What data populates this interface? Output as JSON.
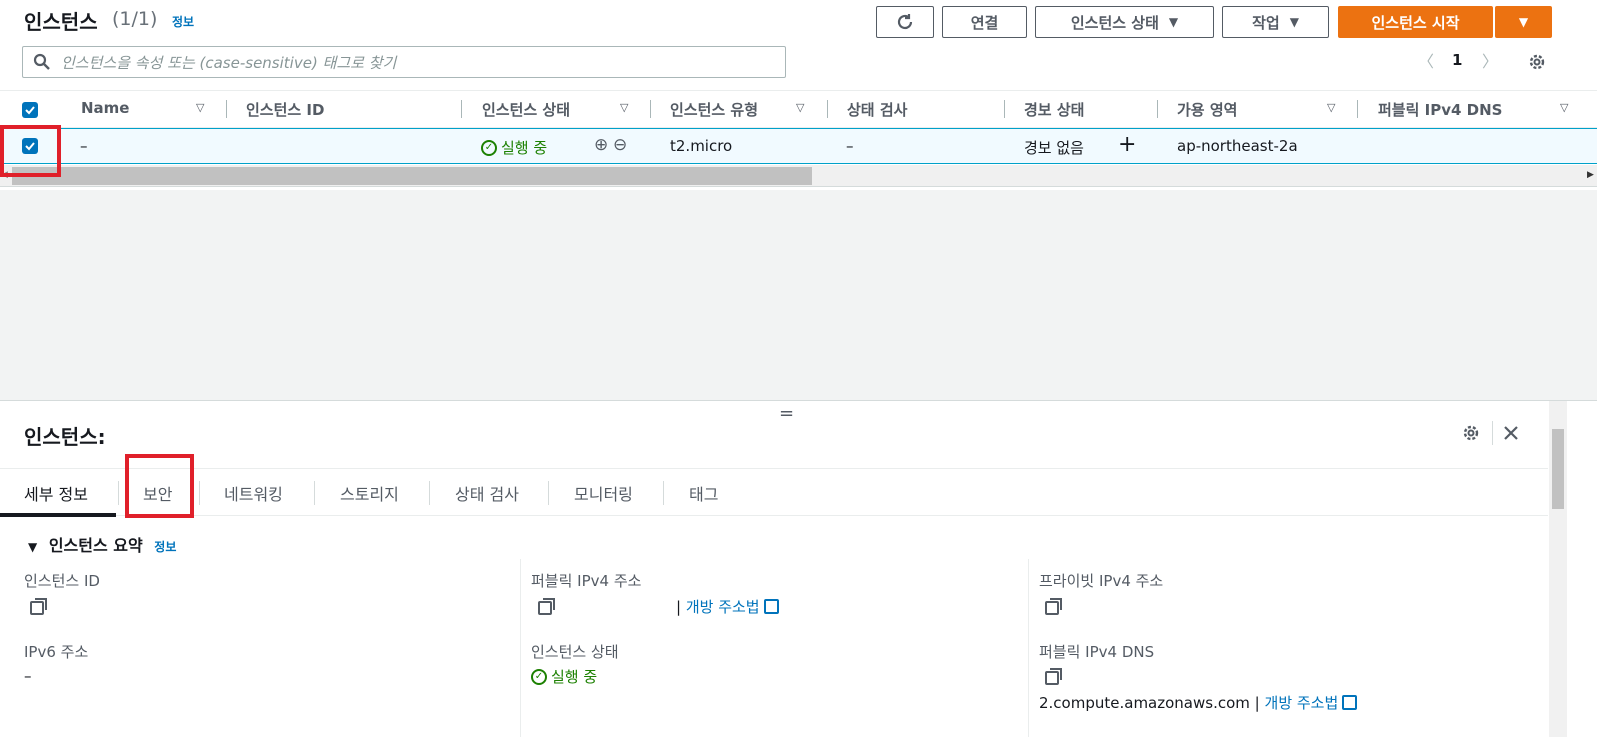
{
  "header": {
    "title": "인스턴스",
    "count": "(1/1)",
    "info": "정보",
    "buttons": {
      "refresh": "refresh-icon",
      "connect": "연결",
      "instance_state": "인스턴스 상태",
      "actions": "작업",
      "launch": "인스턴스 시작"
    }
  },
  "search": {
    "placeholder": "인스턴스을 속성 또는 (case-sensitive) 태그로 찾기"
  },
  "pagination": {
    "page": "1"
  },
  "table": {
    "columns": [
      "Name",
      "인스턴스 ID",
      "인스턴스 상태",
      "인스턴스 유형",
      "상태 검사",
      "경보 상태",
      "가용 영역",
      "퍼블릭 IPv4 DNS"
    ],
    "rows": [
      {
        "name": "–",
        "instance_id": "",
        "state": "실행 중",
        "type": "t2.micro",
        "status_check": "–",
        "alarm": "경보 없음",
        "az": "ap-northeast-2a",
        "dns": ""
      }
    ]
  },
  "panel": {
    "title": "인스턴스:",
    "tabs": [
      "세부 정보",
      "보안",
      "네트워킹",
      "스토리지",
      "상태 검사",
      "모니터링",
      "태그"
    ],
    "active_tab": "세부 정보",
    "summary_title": "인스턴스 요약",
    "summary_info": "정보",
    "fields": {
      "instance_id_label": "인스턴스 ID",
      "public_ip_label": "퍼블릭 IPv4 주소",
      "open_address": "개방 주소법",
      "private_ip_label": "프라이빗 IPv4 주소",
      "ipv6_label": "IPv6 주소",
      "ipv6_value": "–",
      "state_label": "인스턴스 상태",
      "state_value": "실행 중",
      "public_dns_label": "퍼블릭 IPv4 DNS",
      "public_dns_value": "2.compute.amazonaws.com",
      "open_address_2": "개방 주소법",
      "pipe": "|"
    }
  },
  "colors": {
    "primary": "#ec7211",
    "link": "#0073bb",
    "success": "#1d8102",
    "highlight": "#e0202a"
  }
}
